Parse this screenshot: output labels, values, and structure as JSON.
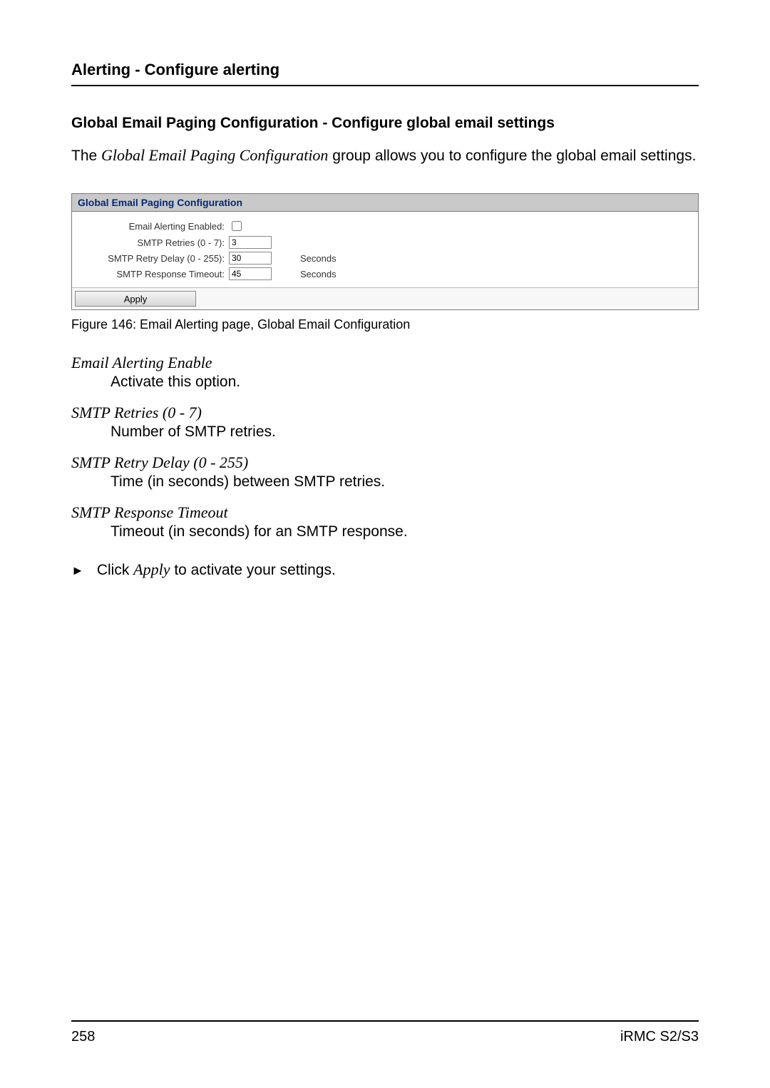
{
  "header": {
    "title": "Alerting - Configure alerting"
  },
  "section": {
    "heading": "Global Email Paging Configuration - Configure global email settings",
    "intro_prefix": "The ",
    "intro_italic": "Global Email Paging Configuration",
    "intro_suffix": " group allows you to configure the global email settings."
  },
  "panel": {
    "title": "Global Email Paging Configuration",
    "rows": {
      "enabled_label": "Email Alerting Enabled:",
      "retries_label": "SMTP Retries (0 - 7):",
      "retries_value": "3",
      "delay_label": "SMTP Retry Delay (0 - 255):",
      "delay_value": "30",
      "delay_unit": "Seconds",
      "timeout_label": "SMTP Response Timeout:",
      "timeout_value": "45",
      "timeout_unit": "Seconds"
    },
    "apply_label": "Apply"
  },
  "caption": "Figure 146: Email Alerting page, Global Email Configuration",
  "defs": [
    {
      "term": "Email Alerting Enable",
      "desc": "Activate this option."
    },
    {
      "term": "SMTP Retries (0 - 7)",
      "desc": "Number of SMTP retries."
    },
    {
      "term": "SMTP Retry Delay (0 - 255)",
      "desc": "Time (in seconds) between SMTP retries."
    },
    {
      "term": "SMTP Response Timeout",
      "desc": "Timeout (in seconds) for an SMTP response."
    }
  ],
  "action": {
    "prefix": "Click ",
    "italic": "Apply",
    "suffix": " to activate your settings."
  },
  "footer": {
    "page": "258",
    "doc": "iRMC S2/S3"
  }
}
